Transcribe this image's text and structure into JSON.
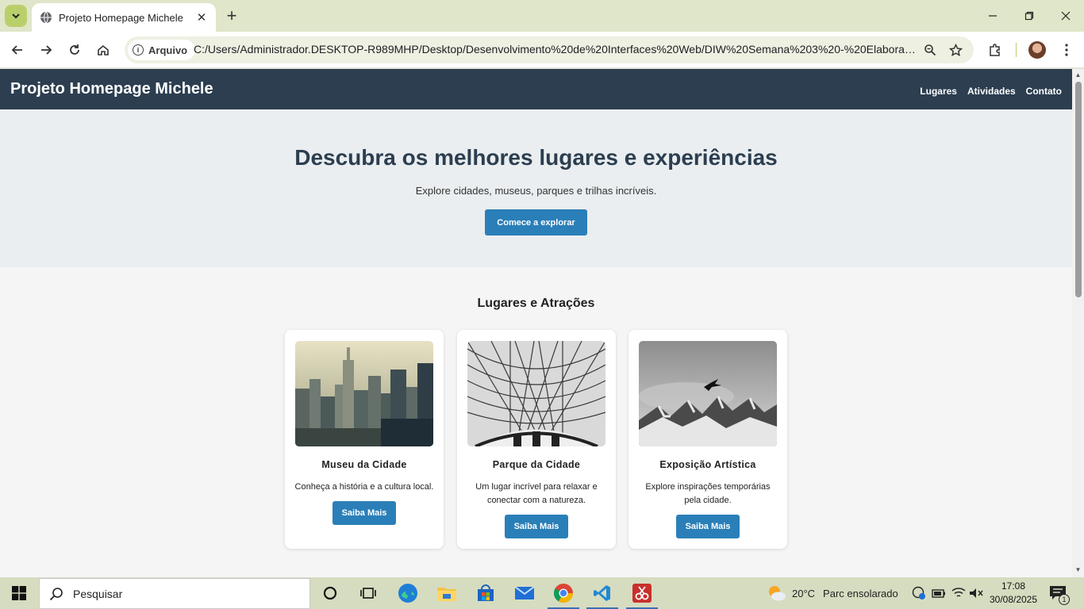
{
  "browser": {
    "tab_title": "Projeto Homepage Michele",
    "security_label": "Arquivo",
    "url": "C:/Users/Administrador.DESKTOP-R989MHP/Desktop/Desenvolvimento%20de%20Interfaces%20Web/DIW%20Semana%203%20-%20Elaboração..."
  },
  "site": {
    "title": "Projeto Homepage Michele",
    "nav": [
      "Lugares",
      "Atividades",
      "Contato"
    ],
    "hero": {
      "heading": "Descubra os melhores lugares e experiências",
      "subtitle": "Explore cidades, museus, parques e trilhas incríveis.",
      "cta": "Comece a explorar"
    },
    "section_title": "Lugares e Atrações",
    "cards": [
      {
        "title": "Museu da Cidade",
        "description": "Conheça a história e a cultura local.",
        "button": "Saiba Mais"
      },
      {
        "title": "Parque da Cidade",
        "description": "Um lugar incrível para relaxar e conectar com a natureza.",
        "button": "Saiba Mais"
      },
      {
        "title": "Exposição Artística",
        "description": "Explore inspirações temporárias pela cidade.",
        "button": "Saiba Mais"
      }
    ]
  },
  "taskbar": {
    "search_placeholder": "Pesquisar",
    "weather_temp": "20°C",
    "weather_desc": "Parc ensolarado",
    "time": "17:08",
    "date": "30/08/2025",
    "notification_count": "1"
  },
  "colors": {
    "header": "#2c3e50",
    "accent": "#2a7fb8",
    "hero_bg": "#eaeef0"
  }
}
